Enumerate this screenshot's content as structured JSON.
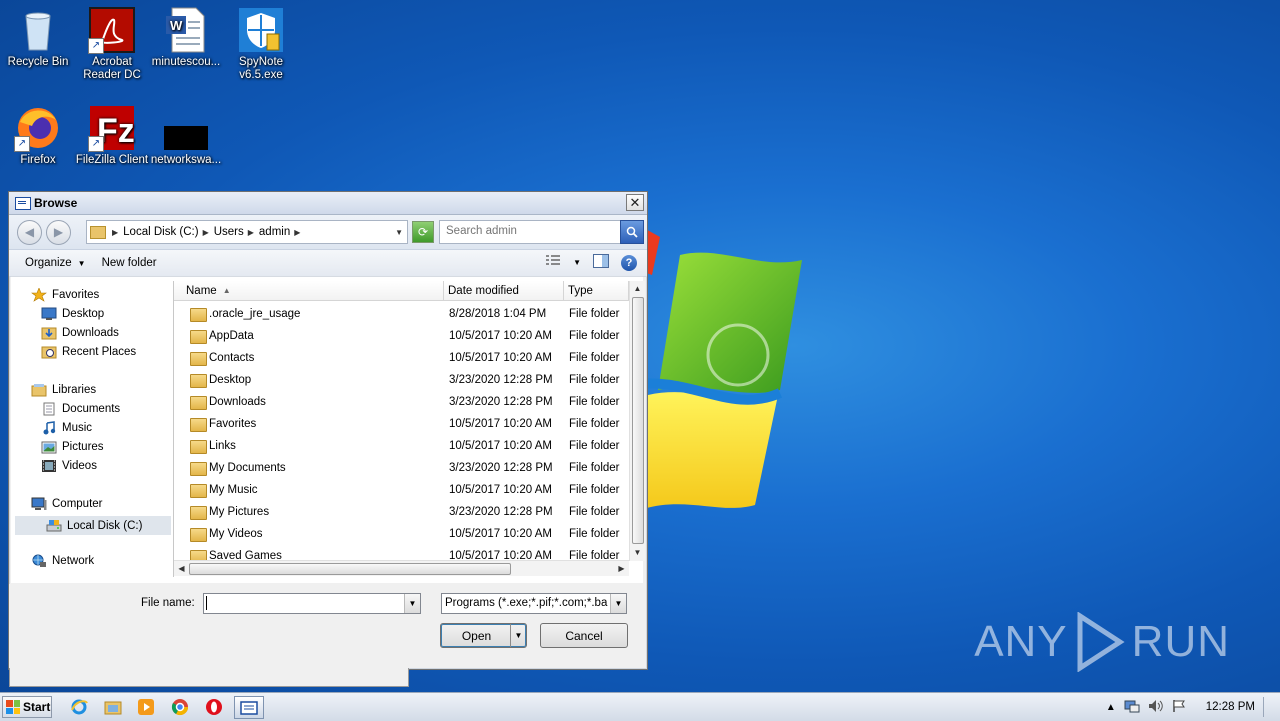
{
  "desktop": {
    "icons": [
      {
        "label": "Recycle Bin",
        "icon": "recycle-bin-icon"
      },
      {
        "label": "Acrobat Reader DC",
        "icon": "acrobat-reader-icon"
      },
      {
        "label": "minutescou...",
        "icon": "word-document-icon"
      },
      {
        "label": "SpyNote v6.5.exe",
        "icon": "shield-exe-icon"
      },
      {
        "label": "Firefox",
        "icon": "firefox-icon"
      },
      {
        "label": "FileZilla Client",
        "icon": "filezilla-icon"
      },
      {
        "label": "networkswa...",
        "icon": "black-thumbnail-icon"
      }
    ],
    "watermark": "ANY RUN"
  },
  "dialog": {
    "title": "Browse",
    "close_glyph": "✕",
    "breadcrumb": [
      "Local Disk (C:)",
      "Users",
      "admin"
    ],
    "search_placeholder": "Search admin",
    "toolbar": {
      "organize": "Organize",
      "new_folder": "New folder"
    },
    "nav": {
      "favorites": "Favorites",
      "desktop": "Desktop",
      "downloads": "Downloads",
      "recent_places": "Recent Places",
      "libraries": "Libraries",
      "documents": "Documents",
      "music": "Music",
      "pictures": "Pictures",
      "videos": "Videos",
      "computer": "Computer",
      "local_disk": "Local Disk (C:)",
      "network": "Network"
    },
    "columns": {
      "name": "Name",
      "date_modified": "Date modified",
      "type": "Type"
    },
    "rows": [
      {
        "name": ".oracle_jre_usage",
        "date": "8/28/2018 1:04 PM",
        "type": "File folder"
      },
      {
        "name": "AppData",
        "date": "10/5/2017 10:20 AM",
        "type": "File folder"
      },
      {
        "name": "Contacts",
        "date": "10/5/2017 10:20 AM",
        "type": "File folder"
      },
      {
        "name": "Desktop",
        "date": "3/23/2020 12:28 PM",
        "type": "File folder"
      },
      {
        "name": "Downloads",
        "date": "3/23/2020 12:28 PM",
        "type": "File folder"
      },
      {
        "name": "Favorites",
        "date": "10/5/2017 10:20 AM",
        "type": "File folder"
      },
      {
        "name": "Links",
        "date": "10/5/2017 10:20 AM",
        "type": "File folder"
      },
      {
        "name": "My Documents",
        "date": "3/23/2020 12:28 PM",
        "type": "File folder"
      },
      {
        "name": "My Music",
        "date": "10/5/2017 10:20 AM",
        "type": "File folder"
      },
      {
        "name": "My Pictures",
        "date": "3/23/2020 12:28 PM",
        "type": "File folder"
      },
      {
        "name": "My Videos",
        "date": "10/5/2017 10:20 AM",
        "type": "File folder"
      },
      {
        "name": "Saved Games",
        "date": "10/5/2017 10:20 AM",
        "type": "File folder"
      }
    ],
    "file_name_label": "File name:",
    "file_name_value": "",
    "file_type": "Programs (*.exe;*.pif;*.com;*.ba",
    "open_label": "Open",
    "cancel_label": "Cancel"
  },
  "taskbar": {
    "start_label": "Start",
    "apps": [
      "internet-explorer-icon",
      "explorer-folder-icon",
      "media-player-icon",
      "chrome-icon",
      "opera-icon",
      "browse-window-icon"
    ],
    "clock": "12:28 PM"
  }
}
